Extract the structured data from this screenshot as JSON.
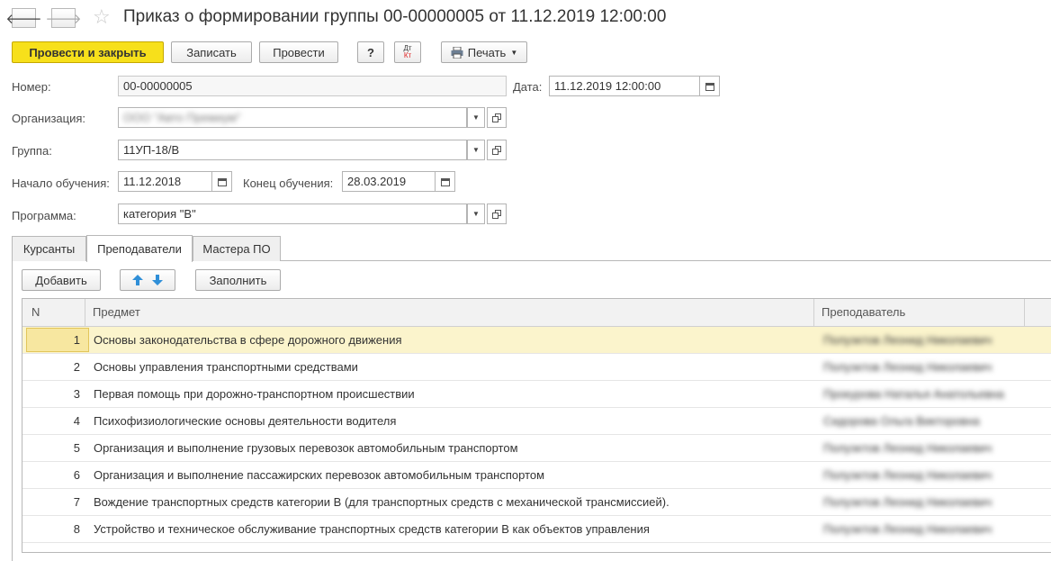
{
  "window": {
    "title": "Приказ о формировании группы 00-00000005 от 11.12.2019 12:00:00",
    "back_glyph": "🡐",
    "forward_glyph": "🡒",
    "star_glyph": "☆"
  },
  "toolbar": {
    "post_close": "Провести и закрыть",
    "save": "Записать",
    "post": "Провести",
    "help": "?",
    "dtkt_top": "Дт",
    "dtkt_bottom": "Кт",
    "print": "Печать"
  },
  "form": {
    "number_label": "Номер:",
    "number_value": "00-00000005",
    "date_label": "Дата:",
    "date_value": "11.12.2019 12:00:00",
    "org_label": "Организация:",
    "org_value": "ООО \"Авто Премиум\"",
    "group_label": "Группа:",
    "group_value": "11УП-18/В",
    "start_label": "Начало обучения:",
    "start_value": "11.12.2018",
    "end_label": "Конец обучения:",
    "end_value": "28.03.2019",
    "program_label": "Программа:",
    "program_value": "категория \"В\""
  },
  "tabs": [
    {
      "label": "Курсанты"
    },
    {
      "label": "Преподаватели"
    },
    {
      "label": "Мастера ПО"
    }
  ],
  "table_toolbar": {
    "add": "Добавить",
    "fill": "Заполнить"
  },
  "table": {
    "headers": {
      "n": "N",
      "subject": "Предмет",
      "teacher": "Преподаватель"
    },
    "rows": [
      {
        "n": "1",
        "subject": "Основы законодательства в сфере дорожного движения",
        "teacher": "Полуэктов Леонид Николаевич"
      },
      {
        "n": "2",
        "subject": "Основы управления транспортными средствами",
        "teacher": "Полуэктов Леонид Николаевич"
      },
      {
        "n": "3",
        "subject": "Первая помощь при дорожно-транспортном происшествии",
        "teacher": "Прокурова Наталья Анатольевна"
      },
      {
        "n": "4",
        "subject": "Психофизиологические основы деятельности водителя",
        "teacher": "Сидорова Ольга Викторовна"
      },
      {
        "n": "5",
        "subject": "Организация и выполнение грузовых перевозок автомобильным транспортом",
        "teacher": "Полуэктов Леонид Николаевич"
      },
      {
        "n": "6",
        "subject": "Организация и выполнение пассажирских перевозок автомобильным транспортом",
        "teacher": "Полуэктов Леонид Николаевич"
      },
      {
        "n": "7",
        "subject": "Вождение транспортных средств категории В (для транспортных средств с механической трансмиссией).",
        "teacher": "Полуэктов Леонид Николаевич"
      },
      {
        "n": "8",
        "subject": "Устройство и техническое обслуживание транспортных средств категории В как объектов управления",
        "teacher": "Полуэктов Леонид Николаевич"
      }
    ]
  },
  "colors": {
    "primary_button": "#f7e01b",
    "selected_row": "#fbf4cc",
    "arrow_icon": "#2f8fd8"
  }
}
